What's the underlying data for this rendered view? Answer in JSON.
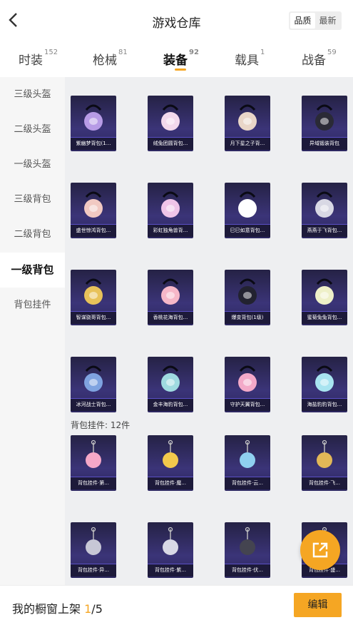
{
  "header": {
    "title": "游戏仓库",
    "sort_options": [
      "品质",
      "最新"
    ],
    "active_sort": "品质"
  },
  "tabs": [
    {
      "label": "时装",
      "count": "152"
    },
    {
      "label": "枪械",
      "count": "81"
    },
    {
      "label": "装备",
      "count": "92"
    },
    {
      "label": "载具",
      "count": "1"
    },
    {
      "label": "战备",
      "count": "59"
    }
  ],
  "sidebar": {
    "items": [
      "三级头盔",
      "二级头盔",
      "一级头盔",
      "三级背包",
      "二级背包",
      "一级背包",
      "背包挂件"
    ],
    "active": "一级背包"
  },
  "backpacks": [
    {
      "name": "紫幽梦背包(1...",
      "icon": "bunny-ear-orb-backpack"
    },
    {
      "name": "绒兔团圆背包...",
      "icon": "bunny-backpack"
    },
    {
      "name": "月下星之子背...",
      "icon": "moon-backpack"
    },
    {
      "name": "异域锻装背包",
      "icon": "dark-armored-backpack"
    },
    {
      "name": "盛世惊鸿背包...",
      "icon": "flower-backpack"
    },
    {
      "name": "彩虹独角兽背...",
      "icon": "unicorn-backpack"
    },
    {
      "name": "巳巳如意背包...",
      "icon": "white-bunny-backpack"
    },
    {
      "name": "燕燕于飞背包...",
      "icon": "swallow-backpack"
    },
    {
      "name": "智谋骁哥背包...",
      "icon": "mask-backpack"
    },
    {
      "name": "香桃花海背包...",
      "icon": "peach-backpack"
    },
    {
      "name": "爆变背包(1级)",
      "icon": "black-bunny-backpack"
    },
    {
      "name": "蜜菊兔兔背包...",
      "icon": "bunny-box-backpack"
    },
    {
      "name": "冰河战士背包...",
      "icon": "warrior-backpack"
    },
    {
      "name": "金丰海豹背包...",
      "icon": "seal-backpack"
    },
    {
      "name": "守护天翼背包...",
      "icon": "wing-backpack"
    },
    {
      "name": "海盐豹豹背包...",
      "icon": "blue-creature-backpack"
    }
  ],
  "charm_section_label": "背包挂件: 12件",
  "charms": [
    {
      "name": "背包挂件·第...",
      "icon": "heart-charm"
    },
    {
      "name": "背包挂件·魔...",
      "icon": "wand-charm"
    },
    {
      "name": "背包挂件·云...",
      "icon": "cloud-charm"
    },
    {
      "name": "背包挂件·飞...",
      "icon": "plane-charm"
    },
    {
      "name": "背包挂件·异...",
      "icon": "wing-charm"
    },
    {
      "name": "背包挂件·紫...",
      "icon": "bell-charm"
    },
    {
      "name": "背包挂件·伏...",
      "icon": "ring-charm"
    },
    {
      "name": "背包挂件·盛...",
      "icon": "lantern-charm"
    }
  ],
  "footer": {
    "label": "我的橱窗上架",
    "current": "1",
    "total": "/5",
    "edit_label": "编辑"
  },
  "fab": {
    "icon": "share-external-icon"
  },
  "colors": {
    "accent": "#f5a623",
    "card_bg": "#2c2760",
    "card_border": "#5a4fc4"
  }
}
